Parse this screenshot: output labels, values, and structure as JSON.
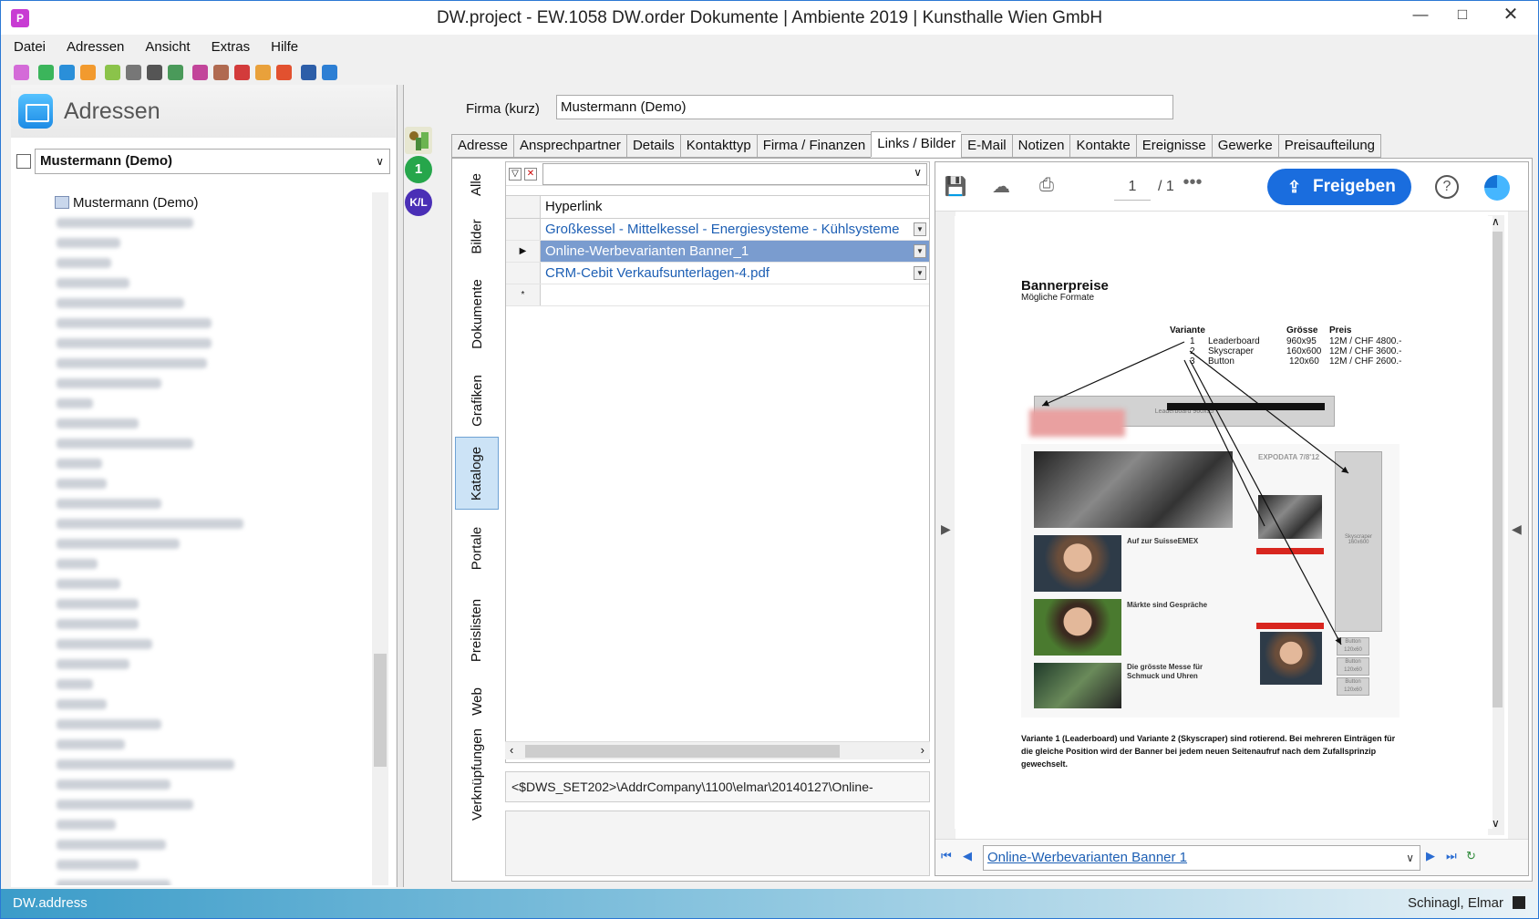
{
  "window": {
    "title": "DW.project - EW.1058 DW.order Dokumente | Ambiente 2019 | Kunsthalle Wien GmbH",
    "app_icon": "project-icon"
  },
  "menu": [
    "Datei",
    "Adressen",
    "Ansicht",
    "Extras",
    "Hilfe"
  ],
  "left": {
    "header": "Adressen",
    "selected": "Mustermann (Demo)",
    "tree_root": "Mustermann (Demo)"
  },
  "form": {
    "firma_label": "Firma (kurz)",
    "firma_value": "Mustermann (Demo)"
  },
  "tabs": [
    "Adresse",
    "Ansprechpartner",
    "Details",
    "Kontakttyp",
    "Firma / Finanzen",
    "Links / Bilder",
    "E-Mail",
    "Notizen",
    "Kontakte",
    "Ereignisse",
    "Gewerke",
    "Preisaufteilung"
  ],
  "active_tab": "Links / Bilder",
  "vtabs": [
    "Alle",
    "Bilder",
    "Dokumente",
    "Grafiken",
    "Kataloge",
    "Portale",
    "Preislisten",
    "Web",
    "Verknüpfungen"
  ],
  "active_vtab": "Kataloge",
  "grid": {
    "header": "Hyperlink",
    "rows": [
      "Großkessel - Mittelkessel - Energiesysteme - Kühlsysteme",
      "Online-Werbevarianten Banner_1",
      "CRM-Cebit Verkaufsunterlagen-4.pdf"
    ],
    "new_row_marker": "*",
    "path": "<$DWS_SET202>\\AddrCompany\\1100\\elmar\\20140127\\Online-"
  },
  "viewer": {
    "page_current": "1",
    "page_total": "/ 1",
    "share_button": "Freigeben",
    "more": "•••",
    "help": "?",
    "doc": {
      "title": "Bannerpreise",
      "subtitle": "Mögliche Formate",
      "col_variante": "Variante",
      "col_groesse": "Grösse",
      "col_preis": "Preis",
      "rows": [
        {
          "nr": "1",
          "name": "Leaderboard",
          "size": "960x95",
          "price": "12M / CHF 4800.-"
        },
        {
          "nr": "2",
          "name": "Skyscraper",
          "size": "160x600",
          "price": "12M / CHF 3600.-"
        },
        {
          "nr": "3",
          "name": "Button",
          "size": "120x60",
          "price": "12M / CHF 2600.-"
        }
      ],
      "leaderboard_label": "Leaderboard 960x95",
      "skyscraper_label": "Skyscraper 160x600",
      "button_label": "Button 120x60",
      "article1_title": "Auf zur SuisseEMEX",
      "article2_title": "Märkte sind Gespräche",
      "article3_title": "Die grösste Messe für Schmuck und Uhren",
      "expodata": "EXPODATA 7/8'12",
      "footnote": "Variante 1 (Leaderboard) und Variante 2 (Skyscraper) sind rotierend. Bei mehreren Einträgen für die gleiche Position wird der Banner bei jedem neuen Seitenaufruf nach dem Zufallsprinzip gewechselt."
    },
    "footer_file": "Online-Werbevarianten Banner 1"
  },
  "status": {
    "left": "DW.address",
    "right": "Schinagl, Elmar"
  }
}
